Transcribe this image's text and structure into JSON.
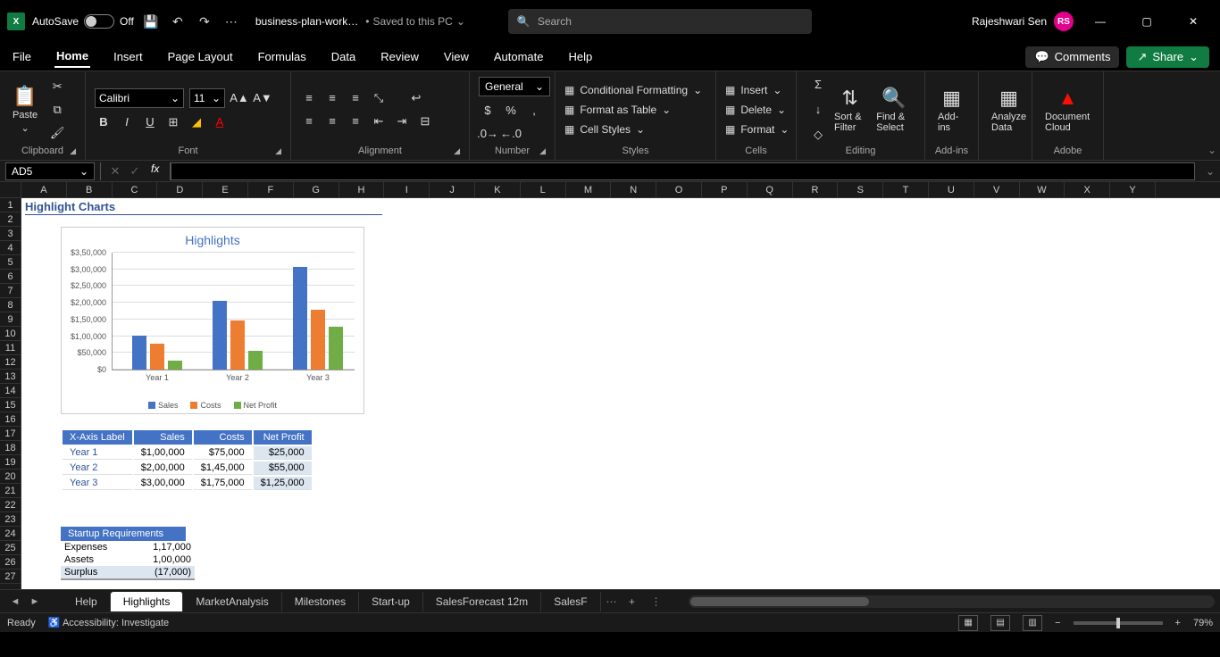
{
  "titlebar": {
    "autosave": "AutoSave",
    "autosave_state": "Off",
    "filename": "business-plan-work…",
    "saved": "Saved to this PC",
    "search_placeholder": "Search",
    "user_name": "Rajeshwari Sen",
    "user_initials": "RS"
  },
  "ribbon_tabs": [
    "File",
    "Home",
    "Insert",
    "Page Layout",
    "Formulas",
    "Data",
    "Review",
    "View",
    "Automate",
    "Help"
  ],
  "active_tab": "Home",
  "ribbon_right": {
    "comments": "Comments",
    "share": "Share"
  },
  "ribbon": {
    "clipboard": {
      "paste": "Paste",
      "label": "Clipboard"
    },
    "font": {
      "name": "Calibri",
      "size": "11",
      "label": "Font"
    },
    "alignment": {
      "label": "Alignment"
    },
    "number": {
      "format": "General",
      "label": "Number"
    },
    "styles": {
      "cond_fmt": "Conditional Formatting",
      "as_table": "Format as Table",
      "cell_styles": "Cell Styles",
      "label": "Styles"
    },
    "cells": {
      "insert": "Insert",
      "delete": "Delete",
      "format": "Format",
      "label": "Cells"
    },
    "editing": {
      "sort_filter": "Sort & Filter",
      "find_select": "Find & Select",
      "label": "Editing"
    },
    "addins": {
      "btn": "Add-ins",
      "label": "Add-ins"
    },
    "analyze": {
      "btn": "Analyze Data"
    },
    "adobe": {
      "btn": "Document Cloud",
      "label": "Adobe"
    }
  },
  "namebox": "AD5",
  "columns": [
    "A",
    "B",
    "C",
    "D",
    "E",
    "F",
    "G",
    "H",
    "I",
    "J",
    "K",
    "L",
    "M",
    "N",
    "O",
    "P",
    "Q",
    "R",
    "S",
    "T",
    "U",
    "V",
    "W",
    "X",
    "Y"
  ],
  "rows": [
    "1",
    "2",
    "3",
    "4",
    "5",
    "6",
    "7",
    "8",
    "9",
    "10",
    "11",
    "12",
    "13",
    "14",
    "15",
    "16",
    "17",
    "18",
    "19",
    "20",
    "21",
    "22",
    "23",
    "24",
    "25",
    "26",
    "27"
  ],
  "section_title": "Highlight Charts",
  "chart_data": {
    "type": "bar",
    "title": "Highlights",
    "categories": [
      "Year 1",
      "Year 2",
      "Year 3"
    ],
    "series": [
      {
        "name": "Sales",
        "values": [
          100000,
          200000,
          300000
        ],
        "color": "#4472C4"
      },
      {
        "name": "Costs",
        "values": [
          75000,
          145000,
          175000
        ],
        "color": "#ED7D31"
      },
      {
        "name": "Net Profit",
        "values": [
          25000,
          55000,
          125000
        ],
        "color": "#70AD47"
      }
    ],
    "yticks": [
      "$0",
      "$50,000",
      "$1,00,000",
      "$1,50,000",
      "$2,00,000",
      "$2,50,000",
      "$3,00,000",
      "$3,50,000"
    ],
    "ylim": [
      0,
      350000
    ]
  },
  "table": {
    "headers": [
      "X-Axis Label",
      "Sales",
      "Costs",
      "Net Profit"
    ],
    "rows": [
      {
        "label": "Year 1",
        "sales": "$1,00,000",
        "costs": "$75,000",
        "np": "$25,000"
      },
      {
        "label": "Year 2",
        "sales": "$2,00,000",
        "costs": "$1,45,000",
        "np": "$55,000"
      },
      {
        "label": "Year 3",
        "sales": "$3,00,000",
        "costs": "$1,75,000",
        "np": "$1,25,000"
      }
    ]
  },
  "startup": {
    "header": "Startup Requirements",
    "rows": [
      {
        "lbl": "Expenses",
        "val": "1,17,000"
      },
      {
        "lbl": "Assets",
        "val": "1,00,000"
      },
      {
        "lbl": "Surplus",
        "val": "(17,000)"
      }
    ]
  },
  "sheet_tabs": [
    "Help",
    "Highlights",
    "MarketAnalysis",
    "Milestones",
    "Start-up",
    "SalesForecast 12m",
    "SalesF"
  ],
  "active_sheet": "Highlights",
  "statusbar": {
    "ready": "Ready",
    "accessibility": "Accessibility: Investigate",
    "zoom": "79%"
  }
}
